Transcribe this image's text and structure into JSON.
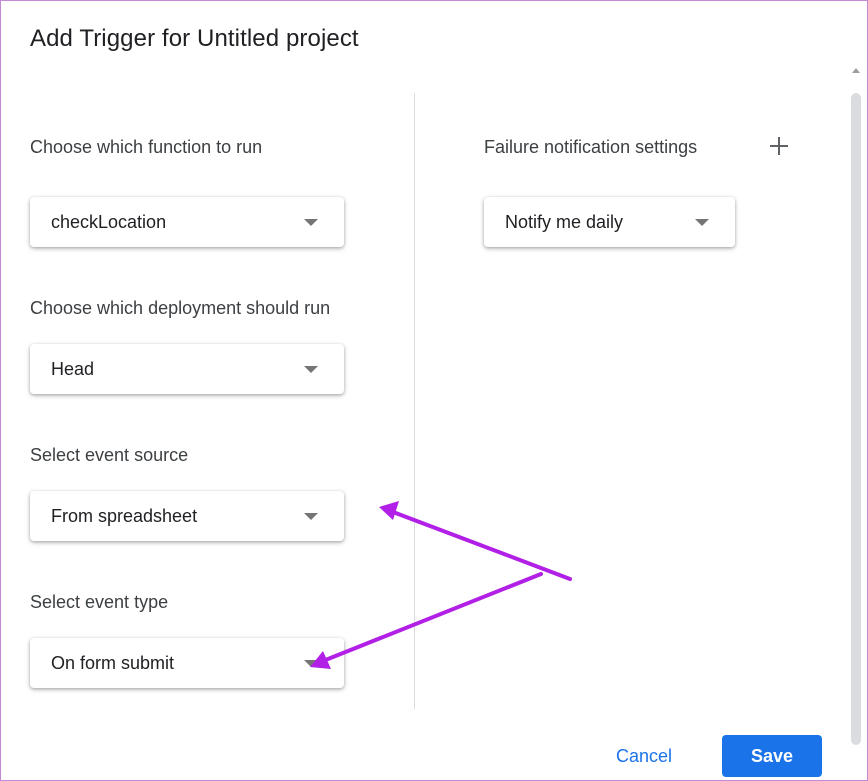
{
  "dialog": {
    "title": "Add Trigger for Untitled project"
  },
  "left": {
    "function": {
      "label": "Choose which function to run",
      "value": "checkLocation"
    },
    "deployment": {
      "label": "Choose which deployment should run",
      "value": "Head"
    },
    "event_source": {
      "label": "Select event source",
      "value": "From spreadsheet"
    },
    "event_type": {
      "label": "Select event type",
      "value": "On form submit"
    }
  },
  "right": {
    "failure": {
      "label": "Failure notification settings",
      "value": "Notify me daily"
    },
    "add_icon": "plus-icon"
  },
  "footer": {
    "cancel_label": "Cancel",
    "save_label": "Save"
  },
  "colors": {
    "accent": "#1a73e8",
    "annotation_arrow": "#b21fe6"
  }
}
